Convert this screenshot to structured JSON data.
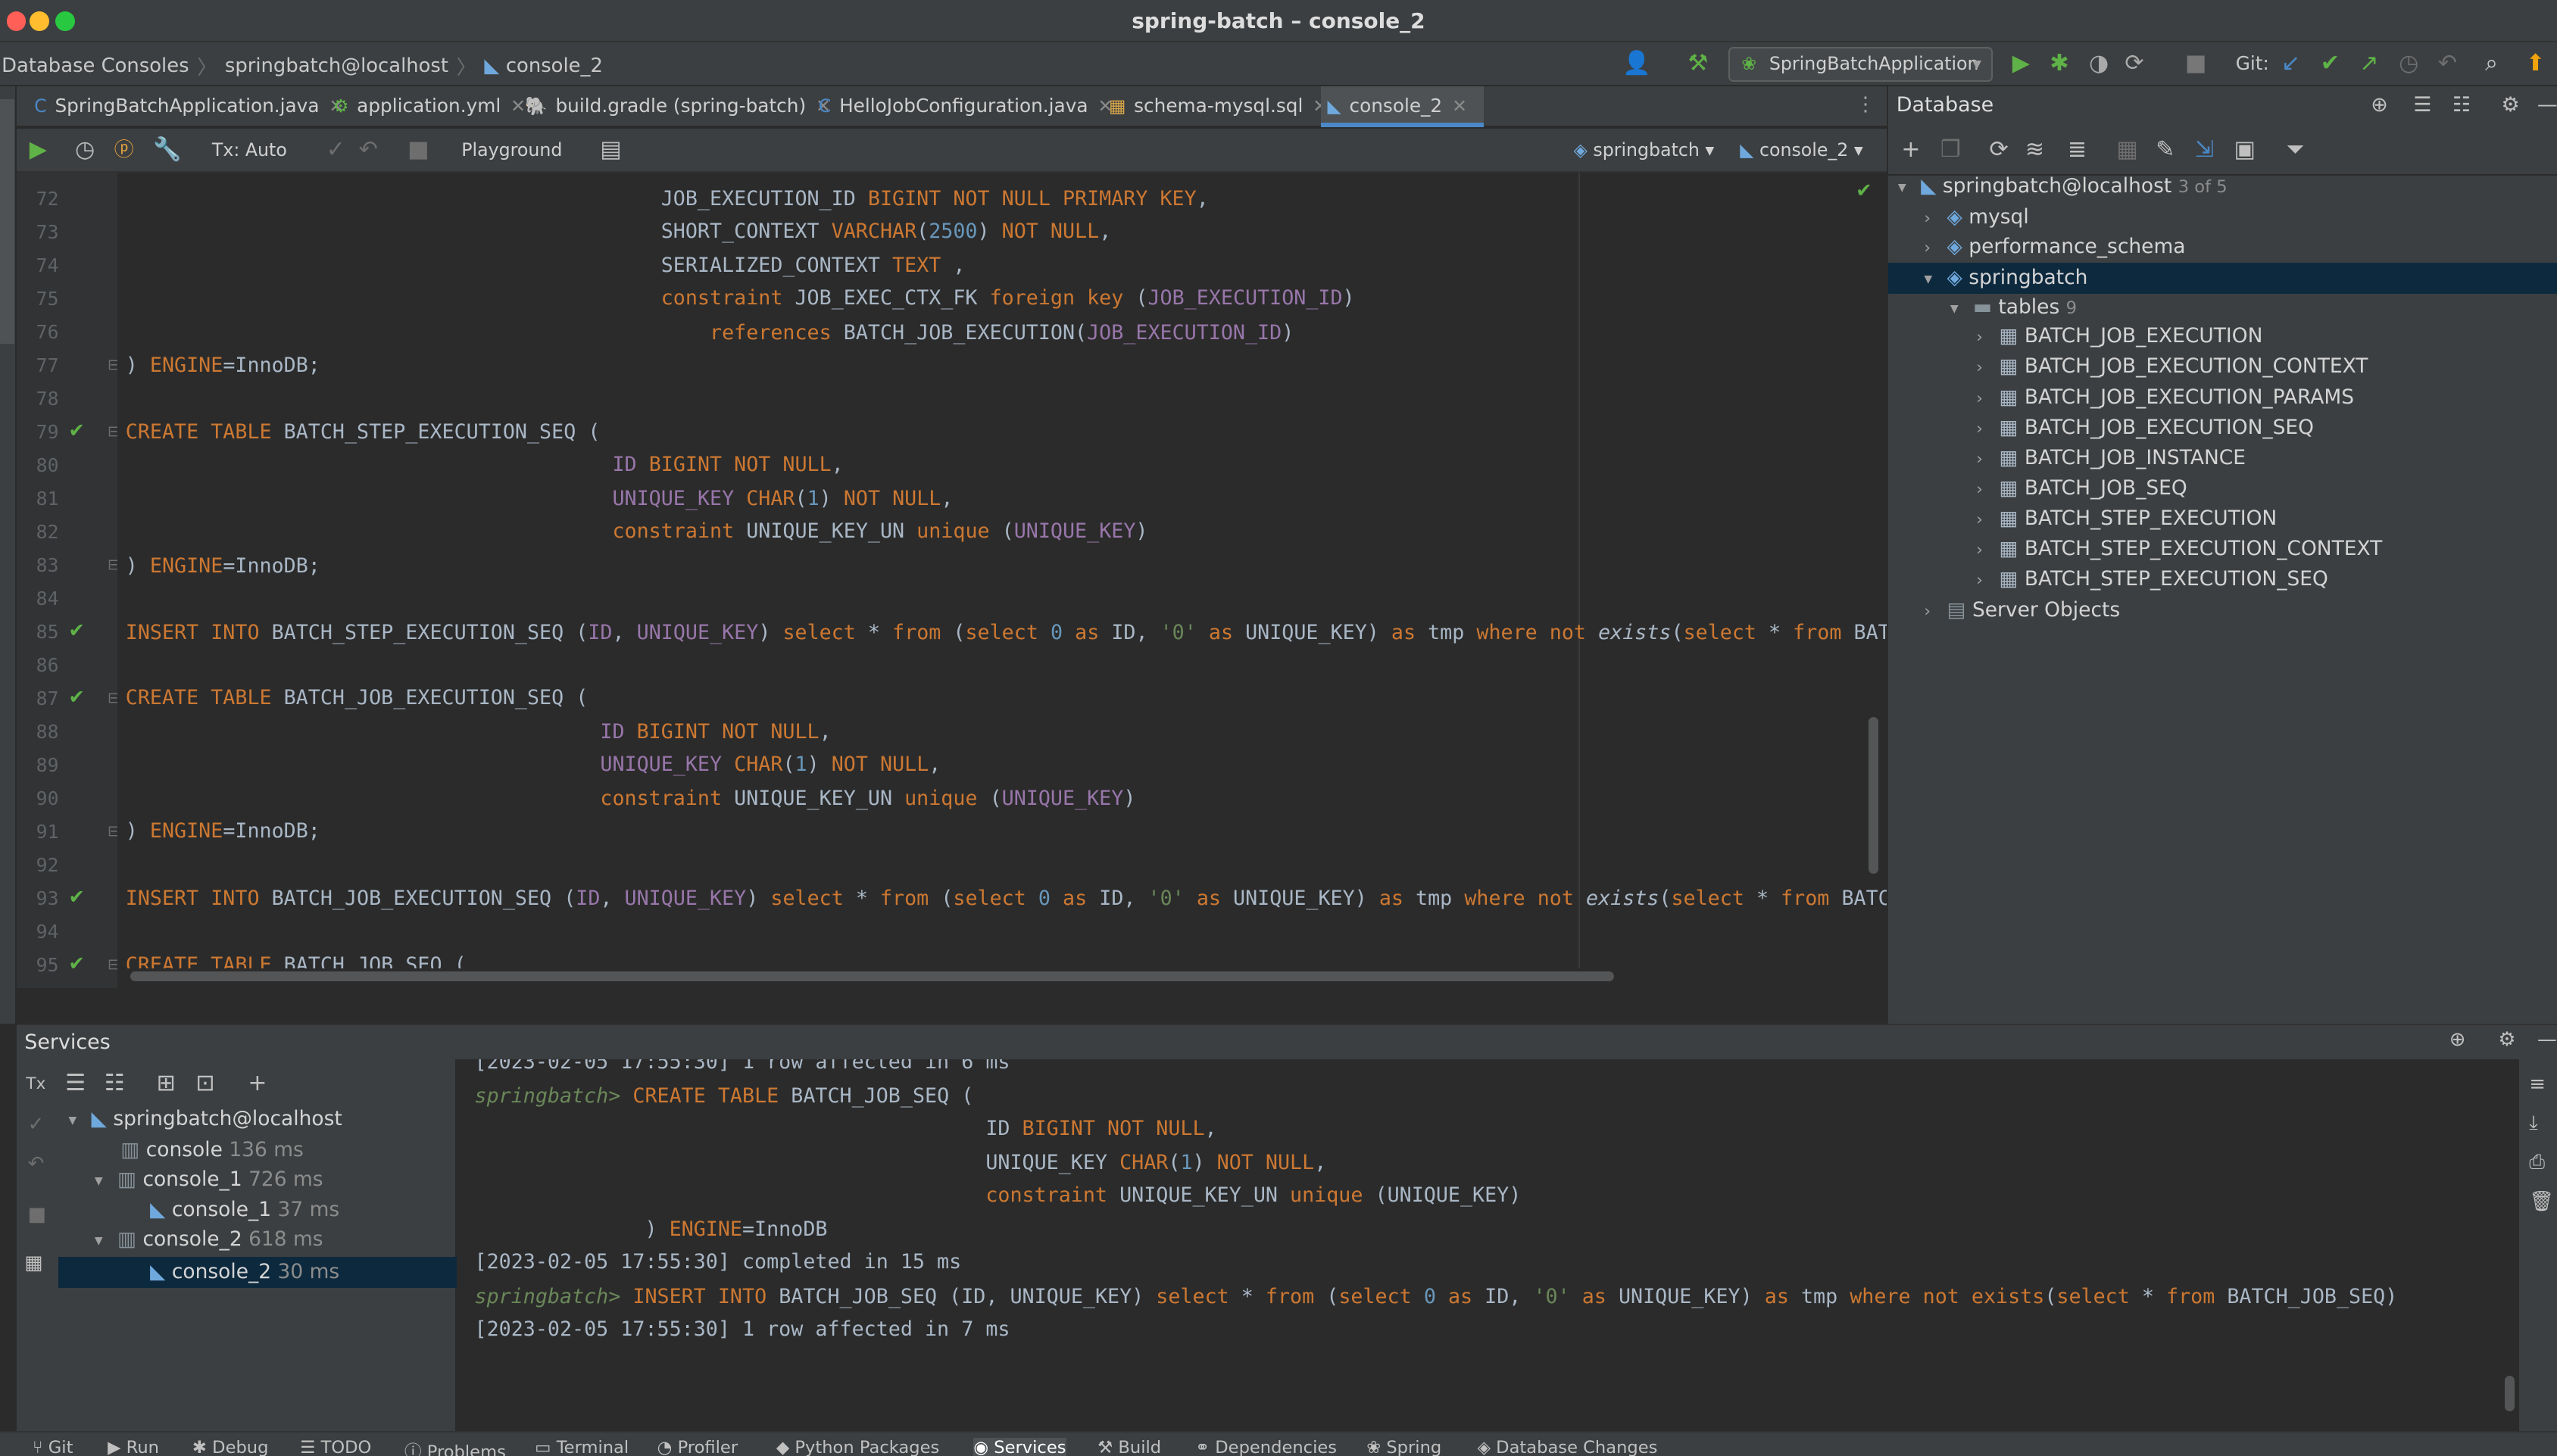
{
  "window": {
    "title": "spring-batch – console_2"
  },
  "navbar": {
    "crumbs": [
      "Database Consoles",
      "springbatch@localhost",
      "console_2"
    ],
    "run_config": "SpringBatchApplication",
    "git_label": "Git:"
  },
  "tabs": [
    {
      "label": "SpringBatchApplication.java",
      "icon": "C"
    },
    {
      "label": "application.yml",
      "icon": "⚙"
    },
    {
      "label": "build.gradle (spring-batch)",
      "icon": "🐘"
    },
    {
      "label": "HelloJobConfiguration.java",
      "icon": "C"
    },
    {
      "label": "schema-mysql.sql",
      "icon": "▦"
    },
    {
      "label": "console_2",
      "icon": "◣"
    }
  ],
  "editor_toolbar": {
    "tx_mode": "Tx: Auto",
    "playground": "Playground",
    "schema": "springbatch",
    "console": "console_2"
  },
  "line_numbers": [
    "72",
    "73",
    "74",
    "75",
    "76",
    "77",
    "78",
    "79",
    "80",
    "81",
    "82",
    "83",
    "84",
    "85",
    "86",
    "87",
    "88",
    "89",
    "90",
    "91",
    "92",
    "93",
    "94",
    "95"
  ],
  "database": {
    "title": "Database",
    "datasource": "springbatch@localhost",
    "datasource_count": "3 of 5",
    "schemas": [
      "mysql",
      "performance_schema",
      "springbatch"
    ],
    "tables_label": "tables",
    "tables_count": "9",
    "tables": [
      "BATCH_JOB_EXECUTION",
      "BATCH_JOB_EXECUTION_CONTEXT",
      "BATCH_JOB_EXECUTION_PARAMS",
      "BATCH_JOB_EXECUTION_SEQ",
      "BATCH_JOB_INSTANCE",
      "BATCH_JOB_SEQ",
      "BATCH_STEP_EXECUTION",
      "BATCH_STEP_EXECUTION_CONTEXT",
      "BATCH_STEP_EXECUTION_SEQ"
    ],
    "server_objects": "Server Objects"
  },
  "services": {
    "title": "Services",
    "tree": [
      {
        "name": "springbatch@localhost",
        "time": ""
      },
      {
        "name": "console",
        "time": "136 ms"
      },
      {
        "name": "console_1",
        "time": "726 ms"
      },
      {
        "name": "console_1",
        "time": "37 ms"
      },
      {
        "name": "console_2",
        "time": "618 ms"
      },
      {
        "name": "console_2",
        "time": "30 ms"
      }
    ],
    "output": {
      "line0": "[2023-02-05 17:55:30] 1 row affected in 6 ms",
      "prompt": "springbatch>",
      "completed": "[2023-02-05 17:55:30] completed in 15 ms",
      "affected": "[2023-02-05 17:55:30] 1 row affected in 7 ms"
    }
  },
  "bottom_tabs": [
    "Git",
    "Run",
    "Debug",
    "TODO",
    "Problems",
    "Terminal",
    "Profiler",
    "Python Packages",
    "Services",
    "Build",
    "Dependencies",
    "Spring",
    "Database Changes"
  ],
  "colors": {
    "accent": "#4a88c7",
    "check": "#5fb247",
    "keyword": "#cc7832",
    "number": "#6897bb",
    "string": "#6a8759",
    "column": "#9876aa"
  }
}
